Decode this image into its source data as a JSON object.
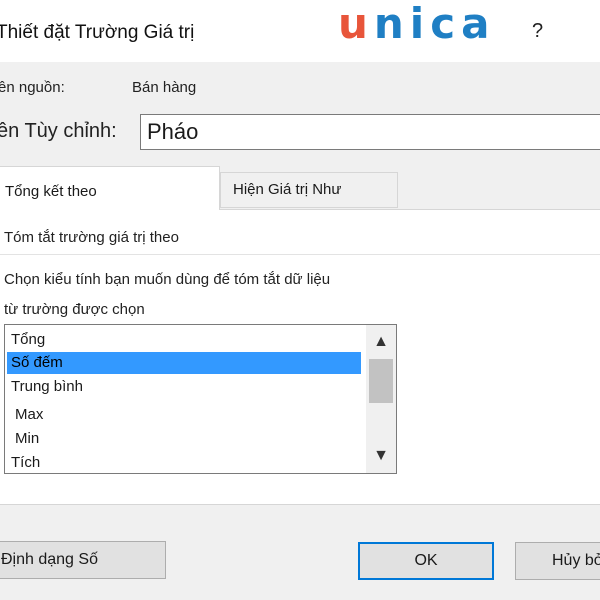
{
  "window": {
    "title": "Thiết đặt Trường Giá trị",
    "help": "?"
  },
  "logo": {
    "first": "u",
    "rest": "nica"
  },
  "source": {
    "label": "ên nguồn:",
    "value": "Bán hàng"
  },
  "custom_name": {
    "label": "ên Tùy chỉnh:",
    "value": "Pháo"
  },
  "tabs": [
    {
      "label": "Tổng kết theo",
      "active": true
    },
    {
      "label": "Hiện Giá trị Như",
      "active": false
    }
  ],
  "panel": {
    "heading": "Tóm tắt trường giá trị theo",
    "desc_line1": "Chọn kiểu tính bạn muốn dùng để tóm tắt dữ liệu",
    "desc_line2": "từ trường được chọn"
  },
  "summary_list": {
    "items": [
      "Tổng",
      "Số đếm",
      "Trung bình",
      "Max",
      "Min",
      "Tích"
    ],
    "selected": "Số đếm",
    "scroll_up": "▲",
    "scroll_down": "▼"
  },
  "buttons": {
    "number_format": "Định dạng Số",
    "ok": "OK",
    "cancel": "Hủy bỏ"
  },
  "colors": {
    "selection": "#3399ff",
    "ok_border": "#0078d7",
    "logo_u": "#e8553a",
    "logo_rest": "#1f7fc4"
  }
}
